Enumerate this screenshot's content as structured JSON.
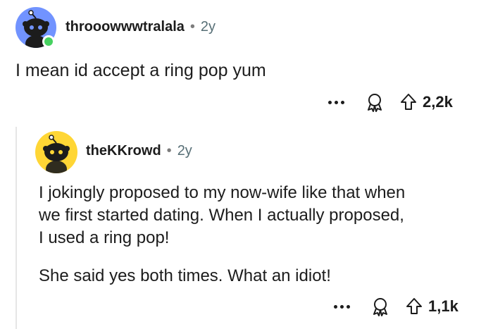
{
  "comment": {
    "username": "throoowwwtralala",
    "separator": "•",
    "age": "2y",
    "text": "I mean id accept a ring pop yum",
    "upvotes": "2,2k",
    "online": true,
    "avatar_color": "#7193ff",
    "online_color": "#46d160",
    "icons": [
      "more-options-icon",
      "award-icon",
      "upvote-arrow-icon"
    ]
  },
  "reply": {
    "username": "theKKrowd",
    "separator": "•",
    "age": "2y",
    "lines": [
      "I jokingly proposed to my now-wife like that when",
      "we first started dating. When I actually proposed,",
      "I used a ring pop!"
    ],
    "second_paragraph": "She said yes both times. What an idiot!",
    "upvotes": "1,1k",
    "avatar_color": "#ffd635",
    "icons": [
      "more-options-icon",
      "award-icon",
      "upvote-arrow-icon"
    ]
  }
}
